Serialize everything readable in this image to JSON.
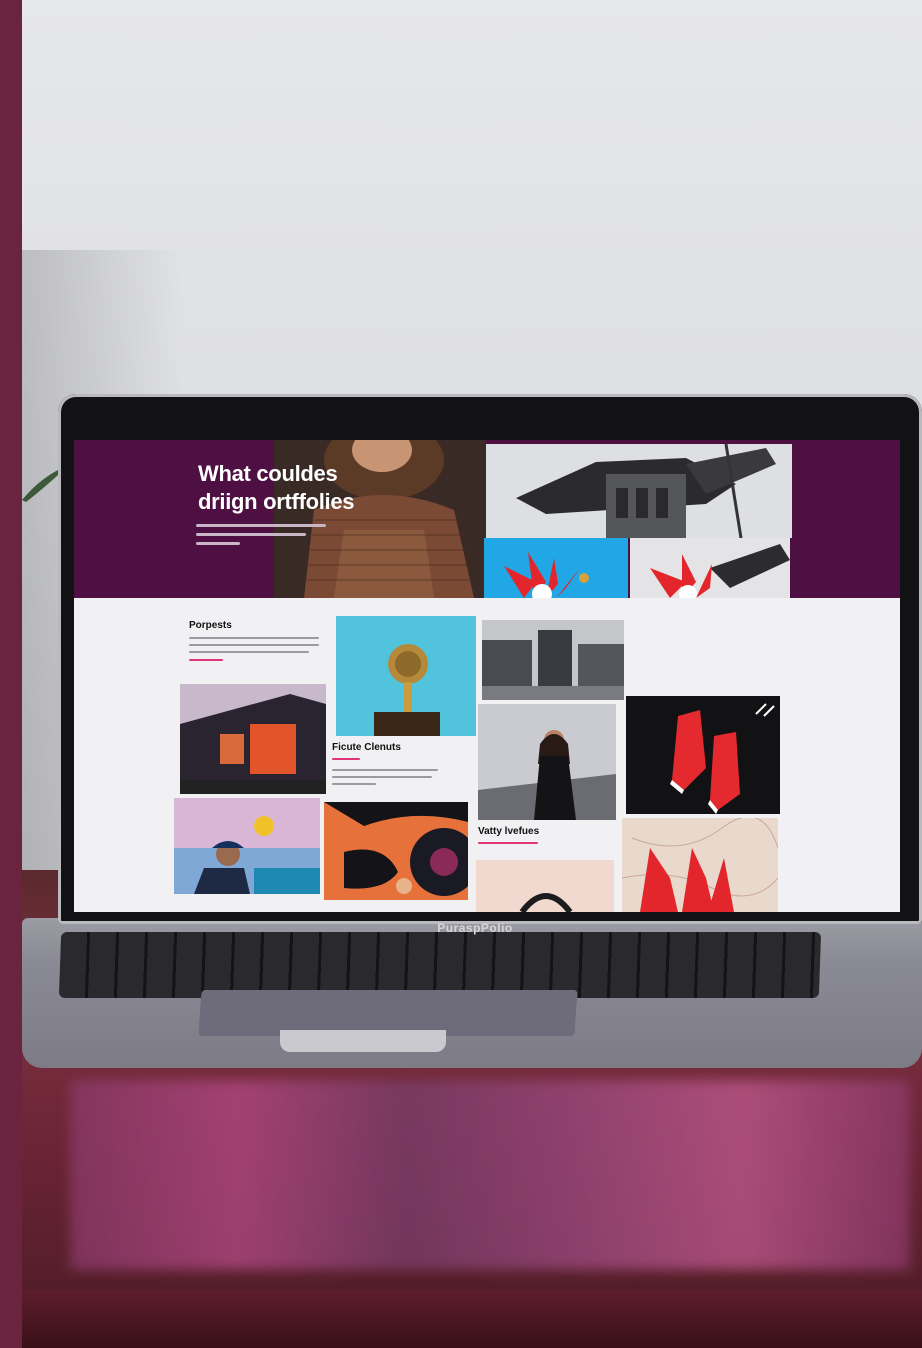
{
  "screen": {
    "hero": {
      "title_line1": "What couldes",
      "title_line2": "driign ortffolies"
    },
    "sections": {
      "projects_heading": "Porpests",
      "card_heading_1": "Ficute Clenuts",
      "card_heading_2": "Vatty lvefues"
    }
  },
  "laptop": {
    "brand_label": "PuraspPolio"
  },
  "colors": {
    "hero_background": "#4e0f42",
    "accent_pink": "#e0357a",
    "side_band": "#6b2440"
  }
}
